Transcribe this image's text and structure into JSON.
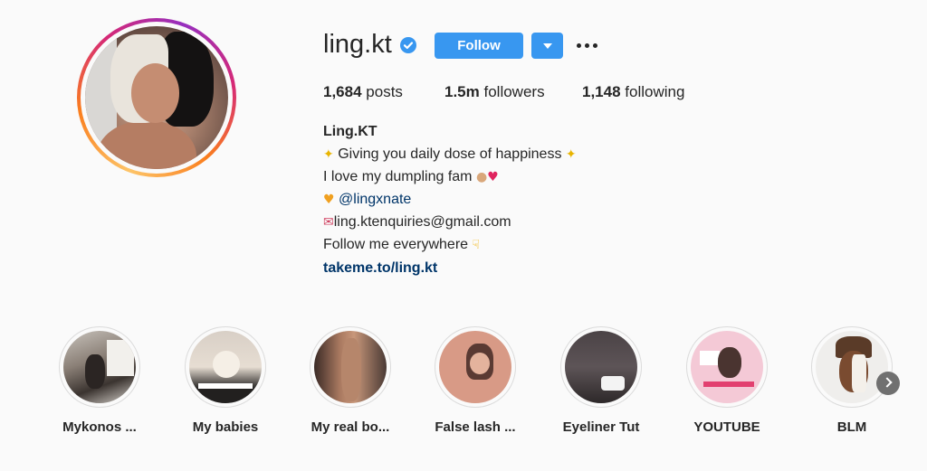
{
  "profile": {
    "username": "ling.kt",
    "follow_label": "Follow",
    "stats": {
      "posts_count": "1,684",
      "posts_label": "posts",
      "followers_count": "1.5m",
      "followers_label": "followers",
      "following_count": "1,148",
      "following_label": "following"
    },
    "bio": {
      "name": "Ling.KT",
      "line1": "Giving you daily dose of happiness",
      "line2": "I love my dumpling fam",
      "mention": "@lingxnate",
      "email": "ling.ktenquiries@gmail.com",
      "line5": "Follow me everywhere",
      "website": "takeme.to/ling.kt"
    }
  },
  "highlights": [
    {
      "label": "Mykonos ...",
      "icon": "highlight-mykonos"
    },
    {
      "label": "My babies",
      "icon": "highlight-babies"
    },
    {
      "label": "My real bo...",
      "icon": "highlight-real-body"
    },
    {
      "label": "False lash ...",
      "icon": "highlight-false-lash"
    },
    {
      "label": "Eyeliner Tut",
      "icon": "highlight-eyeliner"
    },
    {
      "label": "YOUTUBE",
      "icon": "highlight-youtube"
    },
    {
      "label": "BLM",
      "icon": "highlight-blm"
    }
  ],
  "colors": {
    "accent": "#3897f0",
    "link": "#003569",
    "text": "#262626",
    "background": "#fafafa"
  }
}
